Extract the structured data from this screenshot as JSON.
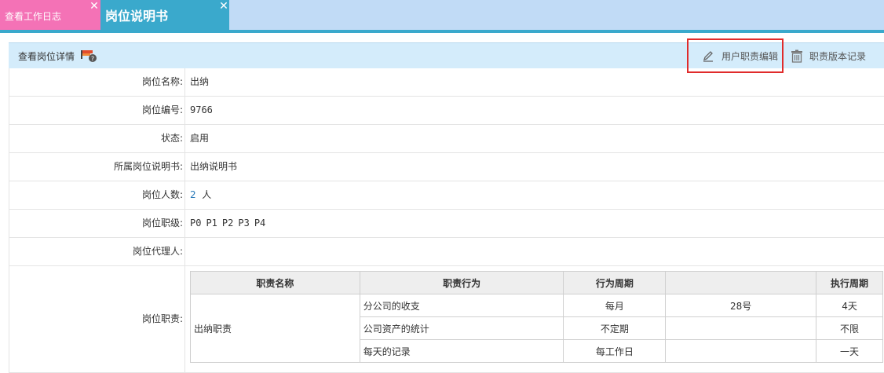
{
  "tabs": [
    {
      "label": "查看工作日志",
      "color": "#f472b6"
    },
    {
      "label": "岗位说明书",
      "color": "#3aa9cc",
      "active": true
    }
  ],
  "panel": {
    "title": "查看岗位详情",
    "edit_label": "用户职责编辑",
    "history_label": "职责版本记录"
  },
  "fields": {
    "name": {
      "label": "岗位名称:",
      "value": "出纳"
    },
    "code": {
      "label": "岗位编号:",
      "value": "9766"
    },
    "status": {
      "label": "状态:",
      "value": "启用"
    },
    "spec": {
      "label": "所属岗位说明书:",
      "value": "出纳说明书"
    },
    "headcount": {
      "label": "岗位人数:",
      "count": "2",
      "unit": "人"
    },
    "grade": {
      "label": "岗位职级:",
      "values": [
        "P0",
        "P1",
        "P2",
        "P3",
        "P4"
      ]
    },
    "proxy": {
      "label": "岗位代理人:",
      "value": ""
    },
    "duties_label": "岗位职责:"
  },
  "duties": {
    "headers": [
      "职责名称",
      "职责行为",
      "行为周期",
      "",
      "执行周期"
    ],
    "group_name": "出纳职责",
    "rows": [
      {
        "action": "分公司的收支",
        "cycle": "每月",
        "day": "28号",
        "exec": "4天"
      },
      {
        "action": "公司资产的统计",
        "cycle": "不定期",
        "day": "",
        "exec": "不限"
      },
      {
        "action": "每天的记录",
        "cycle": "每工作日",
        "day": "",
        "exec": "一天"
      }
    ]
  },
  "colors": {
    "accent": "#3aa9cc",
    "tab_pink": "#f472b6",
    "header_bg": "#d4ecfb",
    "highlight": "#e02b2b"
  }
}
